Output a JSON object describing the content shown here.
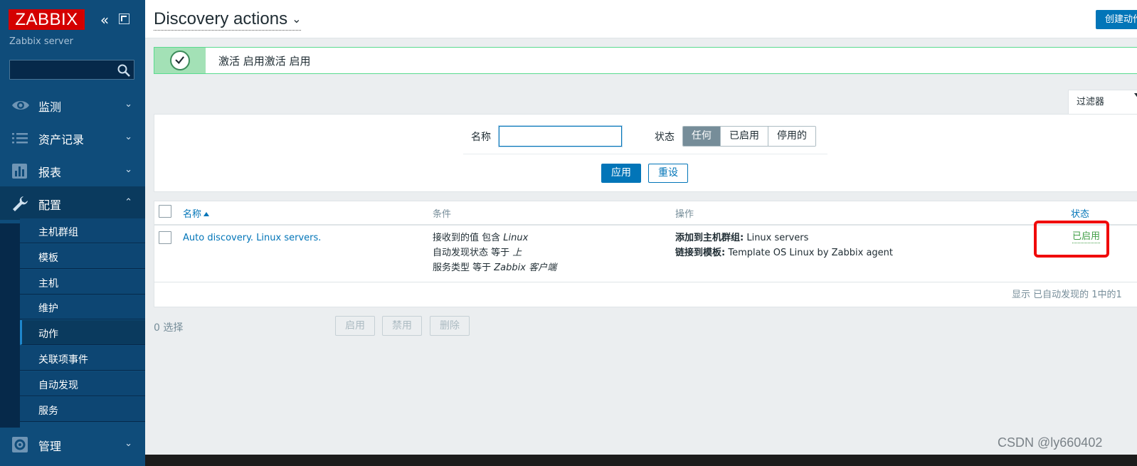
{
  "sidebar": {
    "logo": "ZABBIX",
    "server_name": "Zabbix server",
    "search_placeholder": "",
    "menu": [
      {
        "label": "监测",
        "icon": "eye-icon"
      },
      {
        "label": "资产记录",
        "icon": "list-icon"
      },
      {
        "label": "报表",
        "icon": "bar-chart-icon"
      },
      {
        "label": "配置",
        "icon": "wrench-icon"
      },
      {
        "label": "管理",
        "icon": "gear-icon"
      }
    ],
    "submenu": [
      "主机群组",
      "模板",
      "主机",
      "维护",
      "动作",
      "关联项事件",
      "自动发现",
      "服务"
    ],
    "active_submenu": "动作"
  },
  "header": {
    "title": "Discovery actions",
    "create_button": "创建动作"
  },
  "message": {
    "text": "激活 启用激活 启用"
  },
  "filter": {
    "tab_label": "过滤器",
    "name_label": "名称",
    "name_value": "",
    "status_label": "状态",
    "status_options": [
      "任何",
      "已启用",
      "停用的"
    ],
    "status_selected": "任何",
    "apply": "应用",
    "reset": "重设"
  },
  "table": {
    "headers": {
      "name": "名称",
      "conditions": "条件",
      "operations": "操作",
      "status": "状态"
    },
    "rows": [
      {
        "name": "Auto discovery. Linux servers.",
        "conditions": [
          {
            "prefix": "接收到的值 包含 ",
            "value": "Linux"
          },
          {
            "prefix": "自动发现状态 等于 ",
            "value": "上"
          },
          {
            "prefix": "服务类型 等于 ",
            "value": "Zabbix 客户端"
          }
        ],
        "operations": [
          {
            "label": "添加到主机群组:",
            "value": " Linux servers"
          },
          {
            "label": "链接到模板:",
            "value": " Template OS Linux by Zabbix agent"
          }
        ],
        "status": "已启用"
      }
    ],
    "footer": "显示 已自动发现的 1中的1"
  },
  "bulk": {
    "selected": "0 选择",
    "enable": "启用",
    "disable": "禁用",
    "delete": "删除"
  },
  "watermark": "CSDN @ly660402",
  "colors": {
    "sidebar": "#0f4c7a",
    "accent": "#0275b8",
    "enabled": "#429e47",
    "logo": "#d40000",
    "highlight": "#f00a0a"
  }
}
